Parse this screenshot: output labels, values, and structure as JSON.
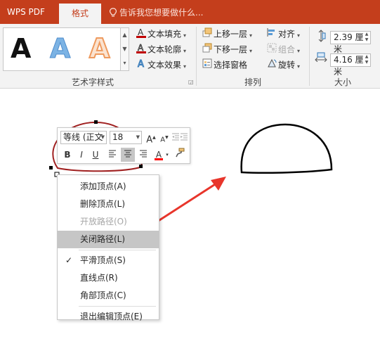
{
  "titlebar": {
    "app_name": "WPS PDF",
    "active_tab": "格式",
    "tell_me": "告诉我您想要做什么..."
  },
  "ribbon": {
    "wordart_styles": {
      "sample_glyphs": [
        "A",
        "A",
        "A"
      ],
      "group_label": "艺术字样式",
      "text_fill": "文本填充",
      "text_outline": "文本轮廓",
      "text_effects": "文本效果"
    },
    "arrange": {
      "group_label": "排列",
      "bring_forward": "上移一层",
      "send_backward": "下移一层",
      "selection_pane": "选择窗格",
      "align": "对齐",
      "group": "组合",
      "rotate": "旋转"
    },
    "size": {
      "group_label": "大小",
      "height": "2.39 厘米",
      "width": "4.16 厘米"
    },
    "colors": {
      "accent": "#c43e1c",
      "text_fill_bar": "#c00000",
      "text_outline_bar": "#c00000",
      "effects_blue": "#2e75b6"
    }
  },
  "mini_toolbar": {
    "font_name": "等线 (正文",
    "font_size": "18",
    "grow_font": "A",
    "shrink_font": "A",
    "bold": "B",
    "italic": "I",
    "underline": "U",
    "font_color_letter": "A",
    "font_color_bar": "#ff0000"
  },
  "context_menu": {
    "items": [
      {
        "label": "添加顶点(A)",
        "enabled": true
      },
      {
        "label": "删除顶点(L)",
        "enabled": true
      },
      {
        "label": "开放路径(O)",
        "enabled": false
      },
      {
        "label": "关闭路径(L)",
        "enabled": true,
        "highlighted": true
      },
      {
        "label": "平滑顶点(S)",
        "enabled": true,
        "checked": true,
        "check_mark": "✓"
      },
      {
        "label": "直线点(R)",
        "enabled": true
      },
      {
        "label": "角部顶点(C)",
        "enabled": true
      },
      {
        "label": "退出编辑顶点(E)",
        "enabled": true
      }
    ]
  },
  "canvas": {
    "shape_outline_color": "#000000",
    "edit_path_color": "#a02020",
    "arrow_color": "#e8352b"
  }
}
